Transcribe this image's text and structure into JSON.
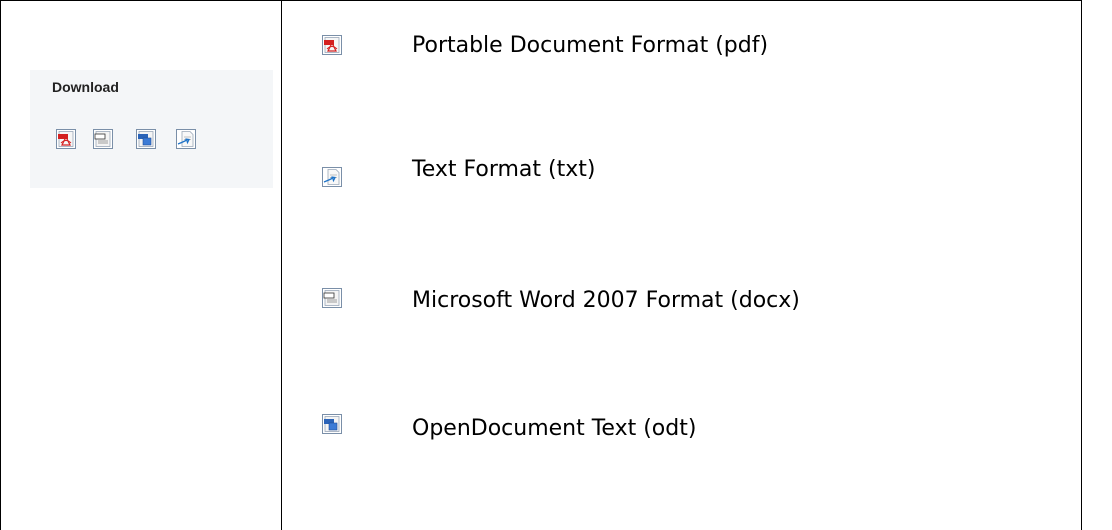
{
  "download": {
    "title": "Download",
    "icons": [
      {
        "icon": "pdf-file-icon",
        "badge": "PDF"
      },
      {
        "icon": "docx-file-icon",
        "badge": "DOCX"
      },
      {
        "icon": "odt-file-icon",
        "badge": "ODT"
      },
      {
        "icon": "txt-file-icon",
        "badge": ""
      }
    ]
  },
  "formats": [
    {
      "icon": "pdf-file-icon",
      "label": "Portable Document Format (pdf)"
    },
    {
      "icon": "txt-file-icon",
      "label": "Text Format (txt)"
    },
    {
      "icon": "docx-file-icon",
      "label": "Microsoft Word 2007 Format (docx)"
    },
    {
      "icon": "odt-file-icon",
      "label": "OpenDocument Text (odt)"
    }
  ],
  "colors": {
    "pdf_accent": "#d42020",
    "odt_accent": "#2a63b8",
    "txt_accent": "#1e73c8",
    "icon_border": "#7a8fa8",
    "panel_bg": "#f4f6f8"
  }
}
